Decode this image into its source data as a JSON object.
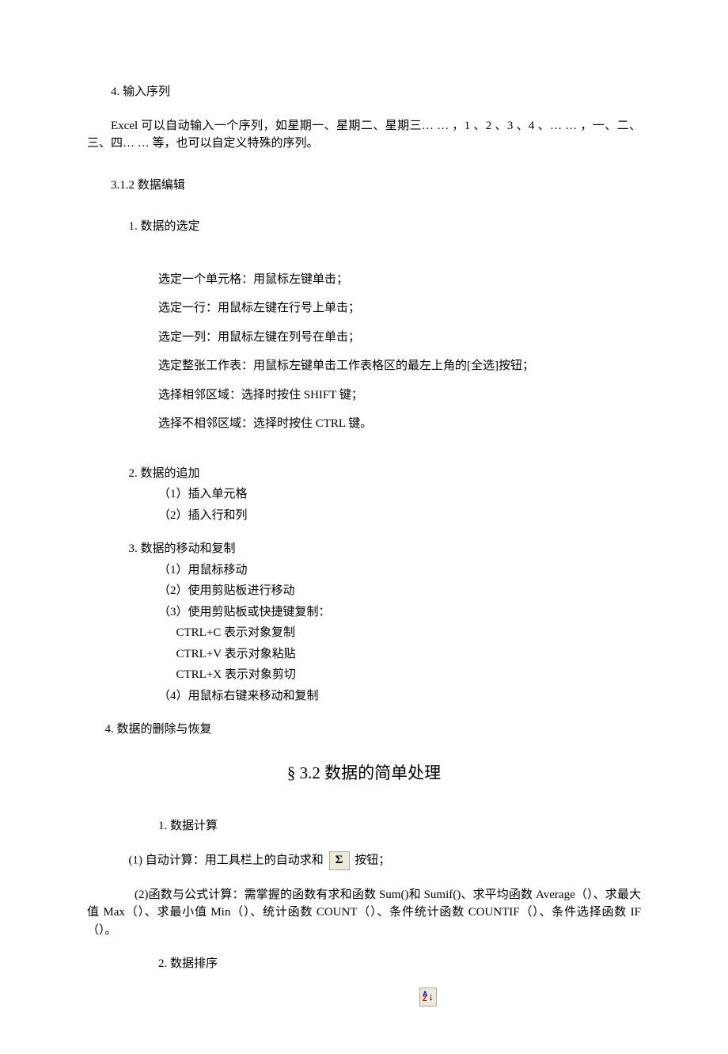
{
  "sec4": {
    "heading": "4. 输入序列",
    "body": "Excel 可以自动输入一个序列，如星期一、星期二、星期三… … ，1 、2 、3 、4 、… … ，一、二、三、四… … 等，也可以自定义特殊的序列。"
  },
  "sec312": {
    "heading": "3.1.2 数据编辑",
    "sub1": {
      "heading": "1. 数据的选定",
      "items": [
        "选定一个单元格：用鼠标左键单击；",
        "选定一行：用鼠标左键在行号上单击；",
        "选定一列：用鼠标左键在列号在单击；",
        "选定整张工作表：用鼠标左键单击工作表格区的最左上角的[全选]按钮；",
        "选择相邻区域：选择时按住 SHIFT 键；",
        "选择不相邻区域：选择时按住 CTRL 键。"
      ]
    },
    "sub2": {
      "heading": "2. 数据的追加",
      "items": [
        "（1）插入单元格",
        "（2）插入行和列"
      ]
    },
    "sub3": {
      "heading": "3. 数据的移动和复制",
      "items": [
        "（1）用鼠标移动",
        "（2）使用剪贴板进行移动",
        "（3）使用剪贴板或快捷键复制：",
        "CTRL+C 表示对象复制",
        "CTRL+V 表示对象粘贴",
        "CTRL+X 表示对象剪切",
        "（4）用鼠标右键来移动和复制"
      ]
    },
    "sub4": {
      "heading": "4. 数据的删除与恢复"
    }
  },
  "sec32": {
    "title": "§ 3.2 数据的简单处理",
    "sub1": {
      "heading": "1. 数据计算",
      "p1_prefix": "(1) 自动计算：用工具栏上的自动求和",
      "p1_suffix": "按钮；",
      "p2": "(2)函数与公式计算：需掌握的函数有求和函数 Sum()和 Sumif()、求平均函数 Average（）、求最大值 Max（）、求最小值 Min（）、统计函数 COUNT（）、条件统计函数 COUNTIF（）、条件选择函数 IF（）。"
    },
    "sub2": {
      "heading": "2. 数据排序"
    }
  },
  "icons": {
    "sigma": "Σ"
  }
}
